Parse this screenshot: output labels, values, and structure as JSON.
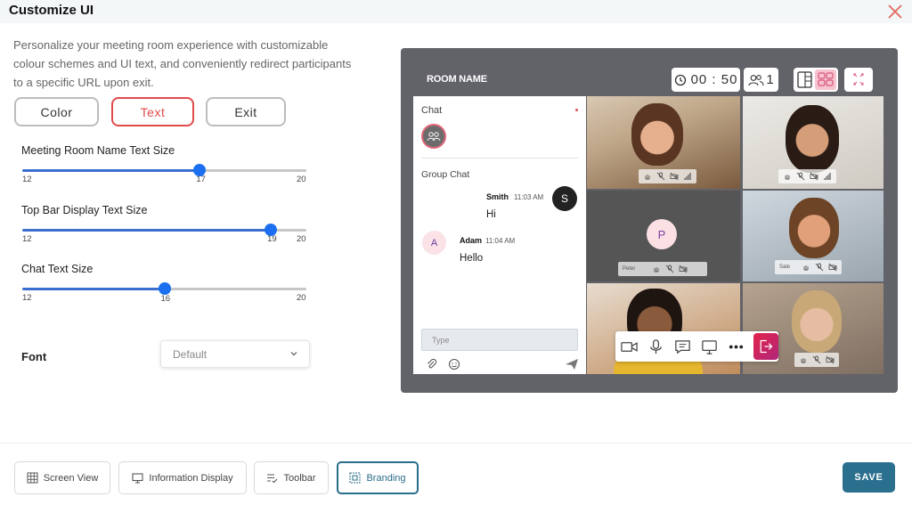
{
  "dialog": {
    "title": "Customize UI",
    "description": "Personalize your meeting room experience with customizable colour schemes and UI text, and conveniently redirect participants to a specific URL upon exit."
  },
  "tabs": [
    {
      "label": "Color",
      "active": false
    },
    {
      "label": "Text",
      "active": true
    },
    {
      "label": "Exit",
      "active": false
    }
  ],
  "sliders": [
    {
      "label": "Meeting Room Name Text Size",
      "min": 12,
      "max": 20,
      "value": 17,
      "min_label": "12",
      "max_label": "20",
      "value_label": "17"
    },
    {
      "label": "Top Bar Display Text Size",
      "min": 12,
      "max": 20,
      "value": 19,
      "min_label": "12",
      "max_label": "20",
      "value_label": "19"
    },
    {
      "label": "Chat Text Size",
      "min": 12,
      "max": 20,
      "value": 16,
      "min_label": "12",
      "max_label": "20",
      "value_label": "16"
    }
  ],
  "font": {
    "label": "Font",
    "selected": "Default"
  },
  "preview": {
    "room_name": "ROOM NAME",
    "timer": "00 : 50",
    "participant_count": "1",
    "chat": {
      "title": "Chat",
      "group_chat_label": "Group Chat",
      "messages": [
        {
          "sender": "Smith",
          "time": "11:03 AM",
          "text": "Hi",
          "initial": "S"
        },
        {
          "sender": "Adam",
          "time": "11:04 AM",
          "text": "Hello",
          "initial": "A"
        }
      ],
      "input_placeholder": "Type"
    },
    "tiles": [
      {
        "name": ""
      },
      {
        "name": ""
      },
      {
        "name": "Peter",
        "initial": "P"
      },
      {
        "name": "Sale"
      },
      {
        "name": ""
      },
      {
        "name": ""
      }
    ]
  },
  "footer": {
    "nav": [
      {
        "label": "Screen View",
        "active": false
      },
      {
        "label": "Information Display",
        "active": false
      },
      {
        "label": "Toolbar",
        "active": false
      },
      {
        "label": "Branding",
        "active": true
      }
    ],
    "save_label": "SAVE"
  },
  "colors": {
    "active_tab": "#e04a4a",
    "slider": "#1b6ff0",
    "save": "#2b6f8f",
    "preview_bg": "#626269"
  }
}
